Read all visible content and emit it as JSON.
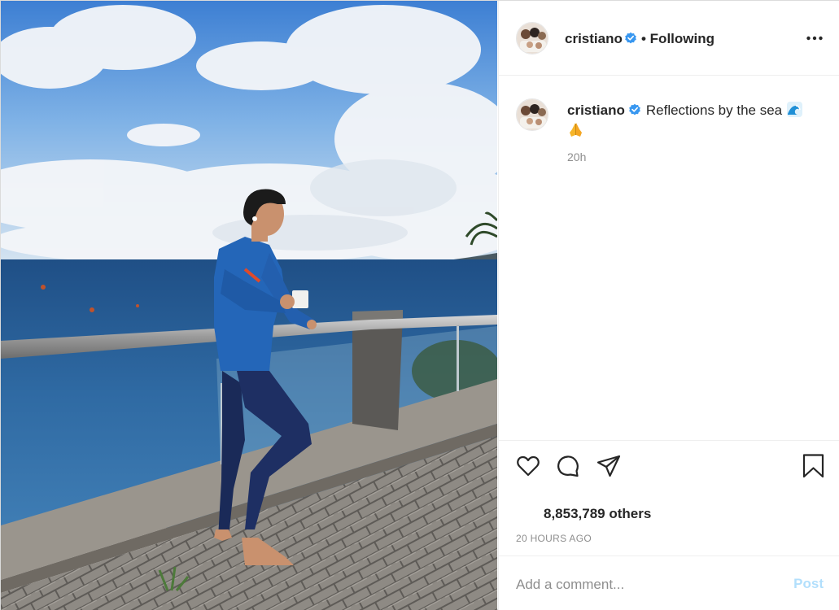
{
  "post": {
    "image_description_icon": "photo"
  },
  "header": {
    "username": "cristiano",
    "separator_following": "• Following",
    "more_icon": "more-horizontal-icon"
  },
  "caption": {
    "username": "cristiano",
    "text": "Reflections by the sea",
    "emojis": [
      "wave-emoji",
      "folded-hands-emoji"
    ],
    "relative_time": "20h"
  },
  "actions": {
    "icons": [
      "heart-icon",
      "comment-icon",
      "share-icon",
      "bookmark-icon"
    ],
    "likes_text": "8,853,789 others",
    "timestamp": "20 HOURS AGO"
  },
  "comment": {
    "placeholder": "Add a comment...",
    "post_label": "Post"
  },
  "colors": {
    "verified_blue": "#3897f0",
    "post_disabled": "#b2dffc",
    "secondary_text": "#8e8e8e",
    "primary_text": "#262626"
  }
}
